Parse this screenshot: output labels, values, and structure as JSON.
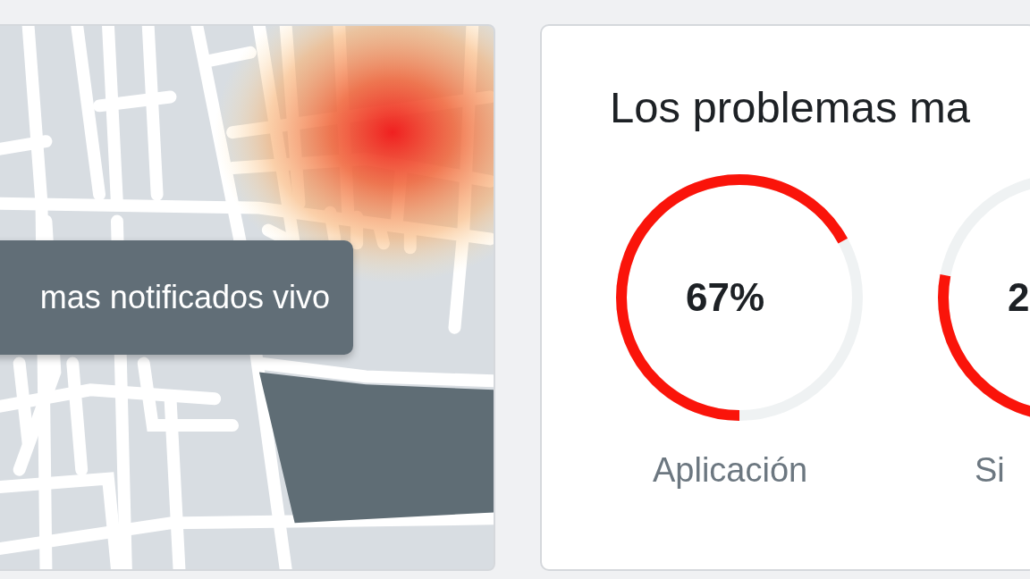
{
  "map": {
    "tooltip": "mas notificados vivo"
  },
  "issues": {
    "title": "Los problemas ma",
    "items": [
      {
        "value": "67%",
        "level": 0.67,
        "label": "Aplicación"
      },
      {
        "value": "2",
        "level": 0.28,
        "label": "Si"
      }
    ]
  }
}
